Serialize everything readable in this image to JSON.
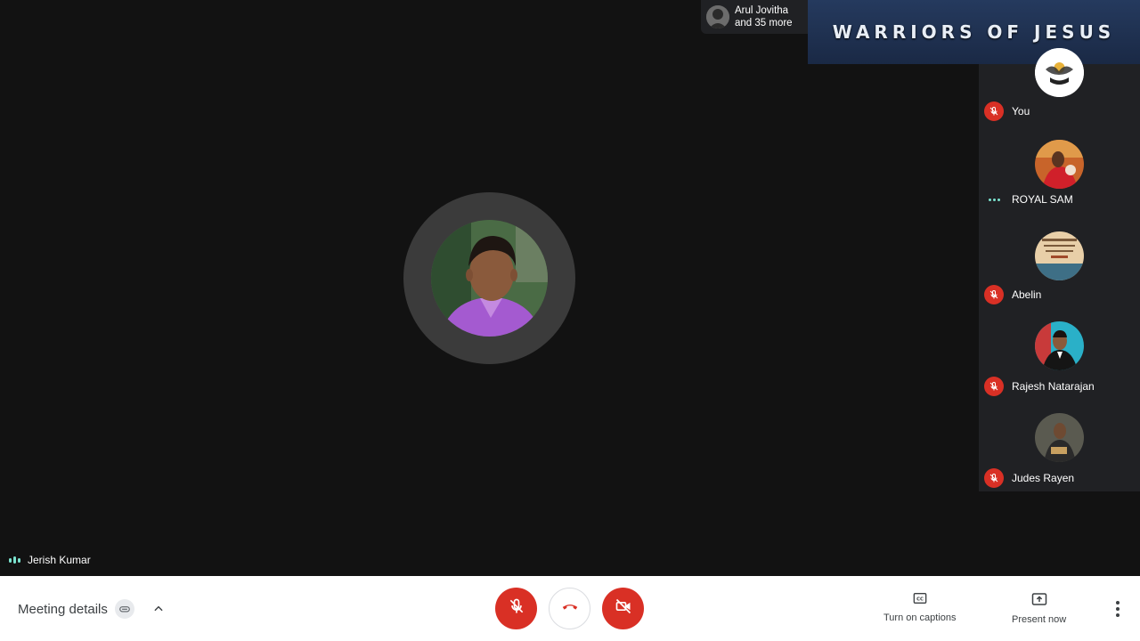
{
  "main": {
    "speaker_name": "Jerish Kumar"
  },
  "others": {
    "line1": "Arul Jovitha",
    "line2": "and 35 more"
  },
  "banner": {
    "text": "WARRIORS OF JESUS"
  },
  "participants": [
    {
      "name": "You",
      "status": "muted"
    },
    {
      "name": "ROYAL SAM",
      "status": "speaking"
    },
    {
      "name": "Abelin",
      "status": "muted"
    },
    {
      "name": "Rajesh Natarajan",
      "status": "muted"
    },
    {
      "name": "Judes Rayen",
      "status": "muted"
    }
  ],
  "bottom_bar": {
    "meeting_details": "Meeting details",
    "captions_label": "Turn on captions",
    "present_label": "Present now"
  },
  "colors": {
    "accent_red": "#d93025",
    "speaking_teal": "#7be3cf",
    "stage_bg": "#121212",
    "panel_bg": "#202124"
  }
}
